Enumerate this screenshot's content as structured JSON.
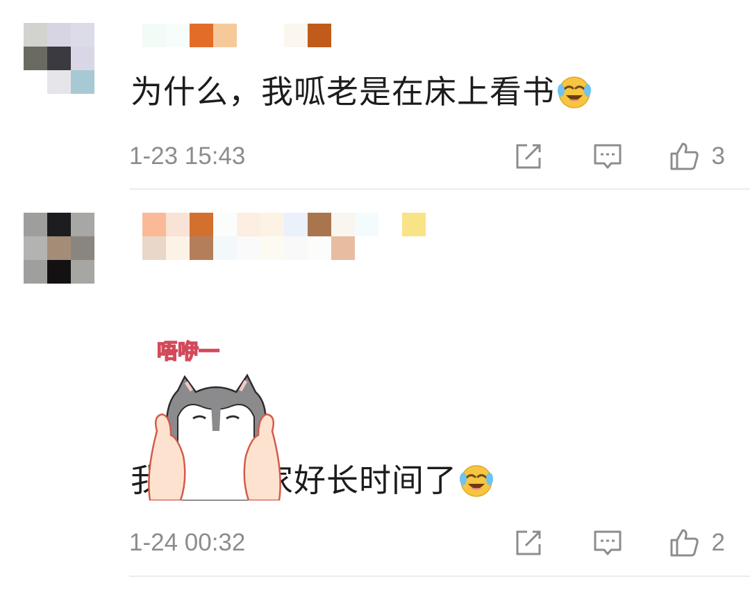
{
  "comments": [
    {
      "text": "为什么，我呱老是在床上看书",
      "emoji": "laughing-crying-emoji",
      "time": "1-23 15:43",
      "likes": "3"
    },
    {
      "text": "我家蛙离家好长时间了",
      "emoji": "laughing-crying-emoji",
      "sticker_text": "唔咿一",
      "time": "1-24 00:32",
      "likes": "2"
    }
  ],
  "colors": {
    "meta_text": "#8c8c8c",
    "icon": "#8c8c8c",
    "divider": "#ececec",
    "emoji_face": "#f7c540"
  },
  "icons": [
    "share-icon",
    "reply-icon",
    "thumbs-up-icon"
  ]
}
